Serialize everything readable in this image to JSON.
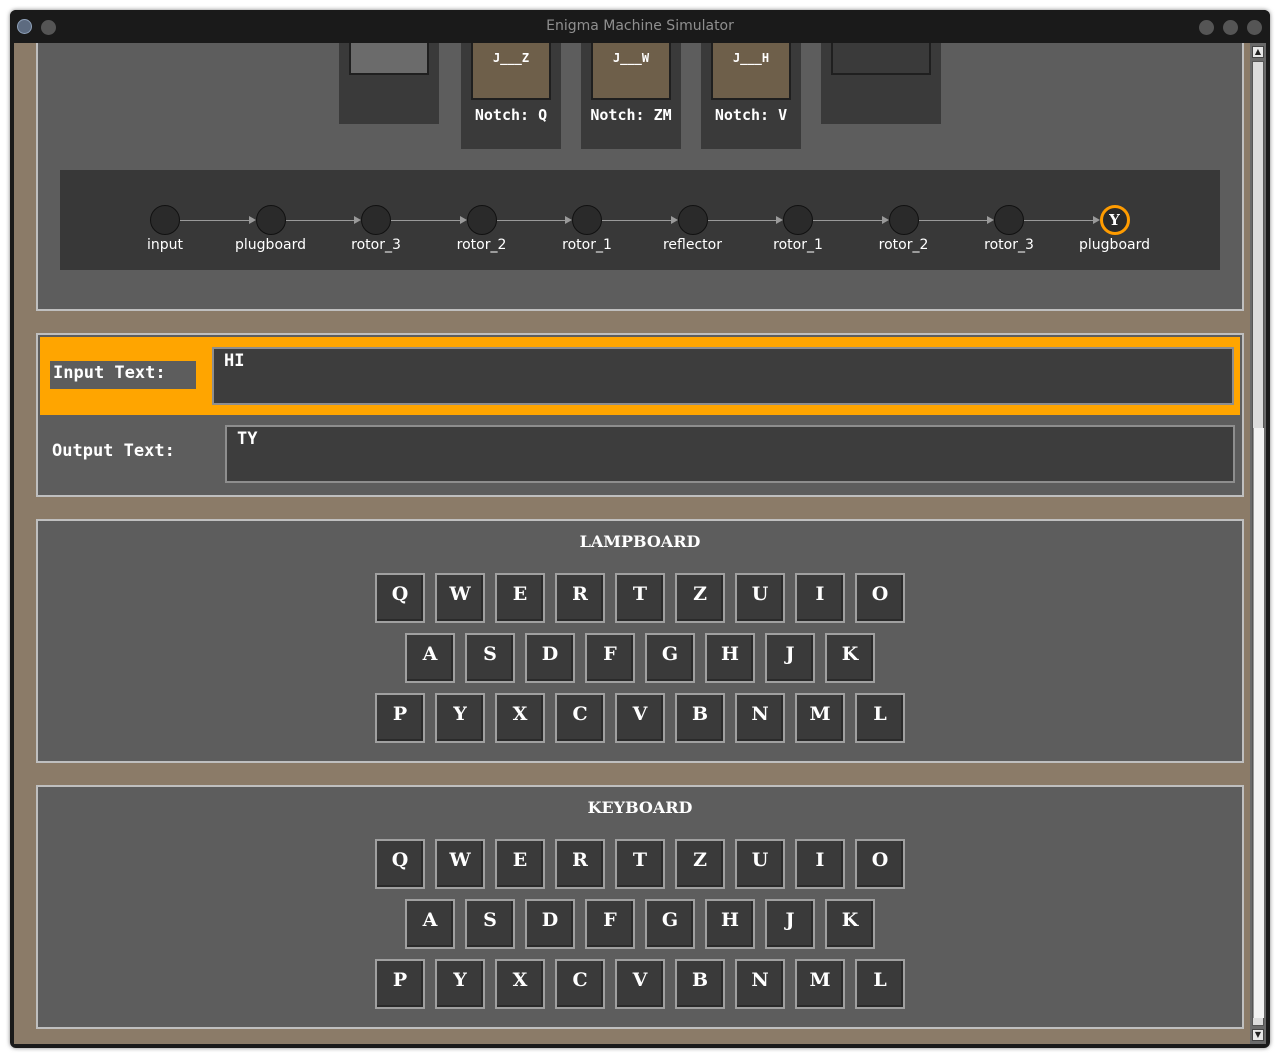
{
  "window": {
    "title": "Enigma Machine Simulator"
  },
  "rotors": [
    {
      "wiring": "J___Z",
      "notch_label": "Notch: Q"
    },
    {
      "wiring": "J___W",
      "notch_label": "Notch: ZM"
    },
    {
      "wiring": "J___H",
      "notch_label": "Notch: V"
    }
  ],
  "signal_path": {
    "nodes": [
      "input",
      "plugboard",
      "rotor_3",
      "rotor_2",
      "rotor_1",
      "reflector",
      "rotor_1",
      "rotor_2",
      "rotor_3",
      "plugboard"
    ],
    "active_letter": "Y"
  },
  "input": {
    "label": "Input Text:",
    "value": "HI"
  },
  "output": {
    "label": "Output Text:",
    "value": "TY"
  },
  "lampboard": {
    "title": "LAMPBOARD",
    "rows": [
      [
        "Q",
        "W",
        "E",
        "R",
        "T",
        "Z",
        "U",
        "I",
        "O"
      ],
      [
        "A",
        "S",
        "D",
        "F",
        "G",
        "H",
        "J",
        "K"
      ],
      [
        "P",
        "Y",
        "X",
        "C",
        "V",
        "B",
        "N",
        "M",
        "L"
      ]
    ]
  },
  "keyboard": {
    "title": "KEYBOARD",
    "rows": [
      [
        "Q",
        "W",
        "E",
        "R",
        "T",
        "Z",
        "U",
        "I",
        "O"
      ],
      [
        "A",
        "S",
        "D",
        "F",
        "G",
        "H",
        "J",
        "K"
      ],
      [
        "P",
        "Y",
        "X",
        "C",
        "V",
        "B",
        "N",
        "M",
        "L"
      ]
    ]
  },
  "colors": {
    "highlight": "#ffa500",
    "background": "#8b7b68",
    "panel": "#5d5d5d"
  }
}
